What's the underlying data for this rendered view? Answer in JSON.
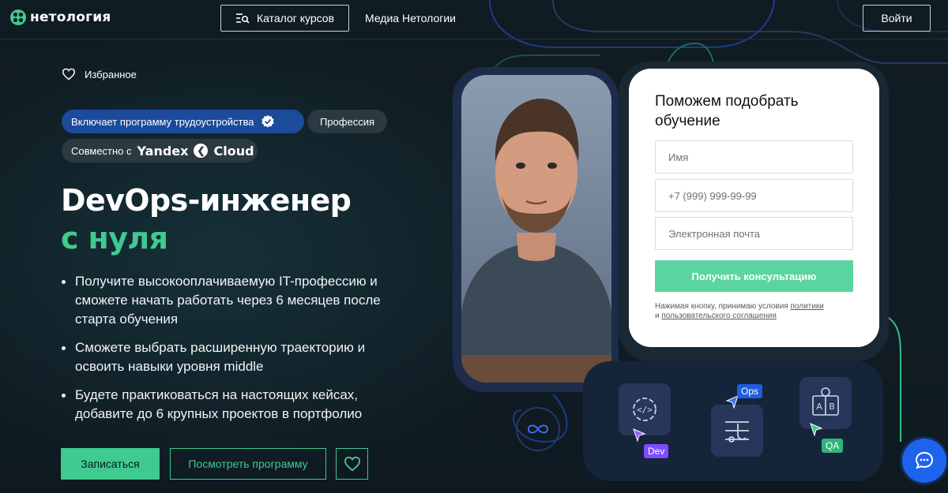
{
  "header": {
    "logo_text": "нетология",
    "catalog_label": "Каталог курсов",
    "media_label": "Медиа Нетологии",
    "login_label": "Войти"
  },
  "hero": {
    "favorite_label": "Избранное",
    "badge_employment": "Включает программу трудоустройства",
    "badge_profession": "Профессия",
    "badge_partner_prefix": "Совместно с",
    "partner_brand_1": "Yandex",
    "partner_brand_2": "Cloud",
    "title": "DevOps-инженер",
    "subtitle": "с нуля",
    "bullets": [
      "Получите высокооплачиваемую IT-профессию и сможете начать работать через 6 месяцев после старта обучения",
      "Сможете выбрать расширенную траекторию и освоить навыки уровня middle",
      "Будете практиковаться на настоящих кейсах, добавите до 6 крупных проектов в портфолио"
    ],
    "enroll_label": "Записаться",
    "program_label": "Посмотреть программу"
  },
  "form": {
    "title": "Поможем подобрать обучение",
    "name_placeholder": "Имя",
    "phone_placeholder": "+7 (999) 999-99-99",
    "email_placeholder": "Электронная почта",
    "submit_label": "Получить консультацию",
    "consent_text": "Нажимая кнопку, принимаю условия",
    "consent_link_1": "политики",
    "consent_and": "и",
    "consent_link_2": "пользовательского соглашения"
  },
  "skills": {
    "tag_dev": "Dev",
    "tag_ops": "Ops",
    "tag_qa": "QA"
  },
  "colors": {
    "accent_green": "#3fca8f",
    "badge_blue": "#1b4b9a",
    "chat_blue": "#1e63ee",
    "background": "#0f1a21"
  },
  "icons": [
    "logo-icon",
    "catalog-icon",
    "heart-icon",
    "verified-icon",
    "yandex-cloud-icon",
    "code-gear-icon",
    "touch-icon",
    "ab-test-icon",
    "infinity-icon",
    "chat-icon"
  ]
}
